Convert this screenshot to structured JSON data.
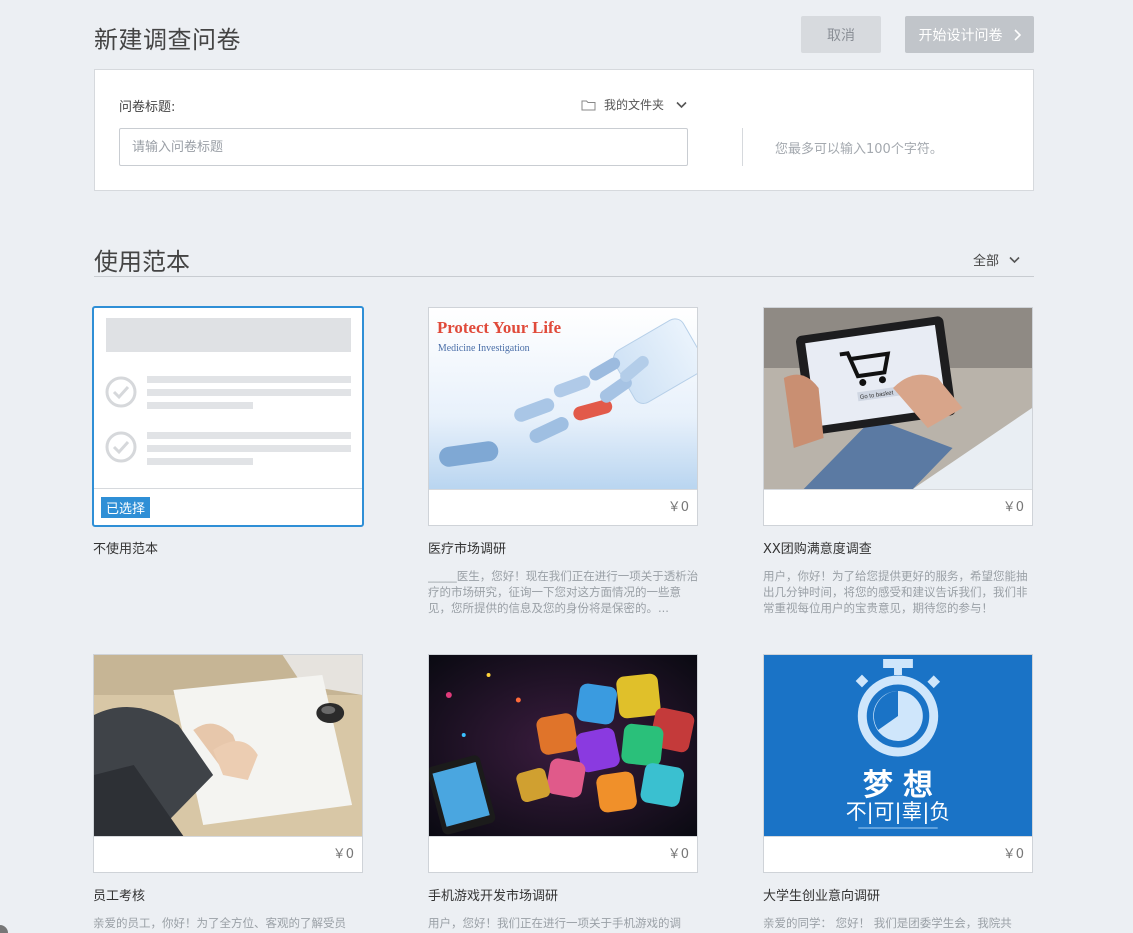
{
  "header": {
    "title": "新建调查问卷",
    "cancel_label": "取消",
    "start_label": "开始设计问卷"
  },
  "form": {
    "title_label": "问卷标题:",
    "folder_label": "我的文件夹",
    "title_placeholder": "请输入问卷标题",
    "title_value": "",
    "hint": "您最多可以输入100个字符。"
  },
  "templates": {
    "section_title": "使用范本",
    "filter_label": "全部",
    "selected_badge": "已选择",
    "items": [
      {
        "name": "不使用范本",
        "price": "",
        "desc": "",
        "selected": true
      },
      {
        "name": "医疗市场调研",
        "price": "￥0",
        "image_title": "Protect Your Life",
        "image_subtitle": "Medicine Investigation",
        "desc": "_____医生，您好！现在我们正在进行一项关于透析治疗的市场研究，征询一下您对这方面情况的一些意见，您所提供的信息及您的身份将是保密的。...",
        "selected": false
      },
      {
        "name": "XX团购满意度调查",
        "price": "￥0",
        "image_text": "Go to basket",
        "desc": "用户，你好！为了给您提供更好的服务，希望您能抽出几分钟时间，将您的感受和建议告诉我们，我们非常重视每位用户的宝贵意见，期待您的参与！",
        "selected": false
      },
      {
        "name": "员工考核",
        "price": "￥0",
        "desc": "亲爱的员工，你好！为了全方位、客观的了解受员",
        "selected": false
      },
      {
        "name": "手机游戏开发市场调研",
        "price": "￥0",
        "desc": "用户，您好！我们正在进行一项关于手机游戏的调",
        "selected": false
      },
      {
        "name": "大学生创业意向调研",
        "price": "￥0",
        "image_title": "梦 想",
        "image_subtitle": "不|可|辜|负",
        "desc": "亲爱的同学： 您好！ 我们是团委学生会，我院共",
        "selected": false
      }
    ]
  },
  "colors": {
    "accent": "#2f8fd6",
    "background": "#eceff3",
    "dream_blue": "#1a73c6"
  }
}
